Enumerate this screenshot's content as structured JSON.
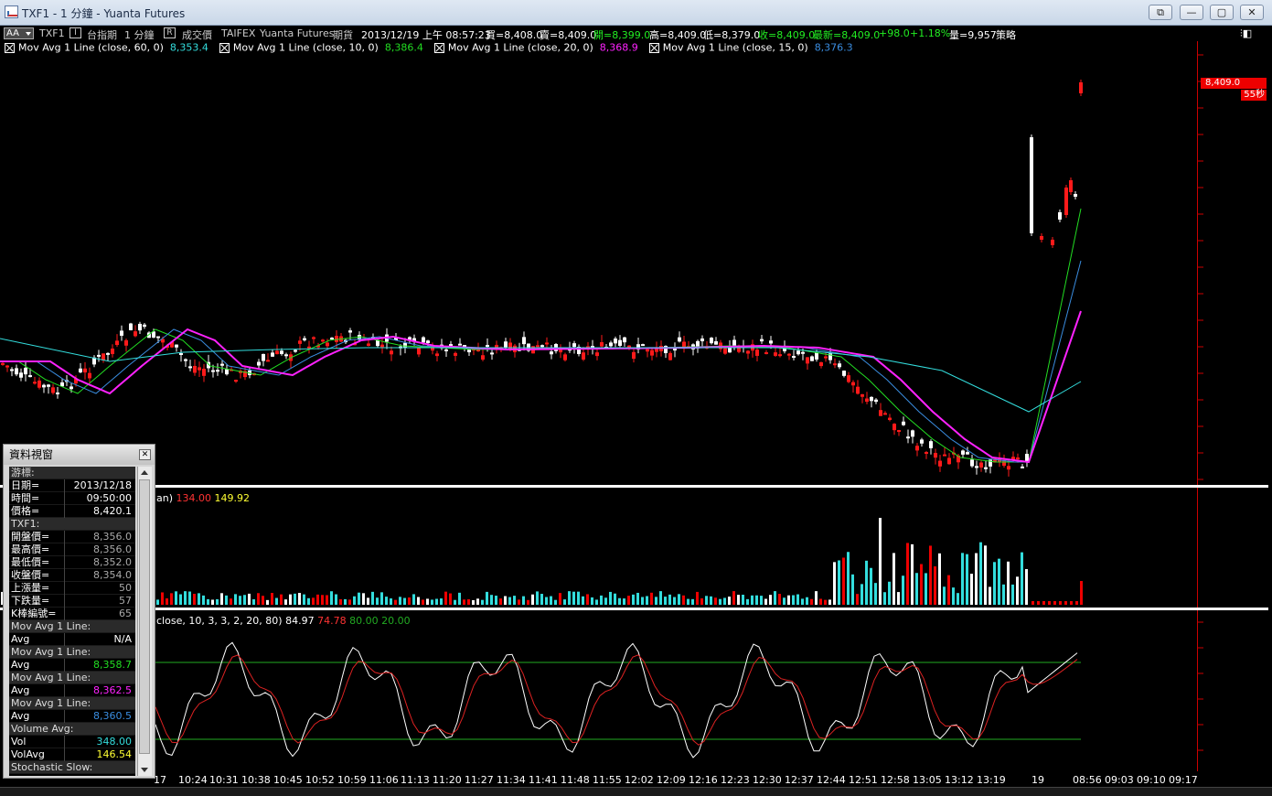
{
  "window": {
    "title": "TXF1 - 1 分鐘 - Yuanta Futures",
    "buttons": [
      "⧉",
      "—",
      "▢",
      "✕"
    ]
  },
  "toolbar": {
    "font_btn": "AA",
    "symbol": "TXF1",
    "box1": "I",
    "name": "台指期",
    "interval": "1 分鐘",
    "box2": "R",
    "price_type": "成交價",
    "exchange": "TAIFEX",
    "broker": "Yuanta Futures",
    "product": "期貨",
    "datetime": "2013/12/19  上午 08:57:23",
    "bid": "買=8,408.0",
    "ask": "賣=8,409.0",
    "open": "開=8,399.0",
    "high": "高=8,409.0",
    "low": "低=8,379.0",
    "close": "收=8,409.0",
    "last": "最新=8,409.0",
    "change": "+98.0",
    "change_pct": "+1.18%",
    "volume": "量=9,957",
    "strategy": "策略",
    "right_icon": "⫶◧"
  },
  "indicators": [
    {
      "label": "Mov Avg 1 Line  (close,  60,  0)",
      "value": "8,353.4",
      "color": "#33dddd"
    },
    {
      "label": "Mov Avg 1 Line  (close,  10,  0)",
      "value": "8,386.4",
      "color": "#22dd22"
    },
    {
      "label": "Mov Avg 1 Line  (close,  20,  0)",
      "value": "8,368.9",
      "color": "#ff22ff"
    },
    {
      "label": "Mov Avg 1 Line  (close,  15,  0)",
      "value": "8,376.3",
      "color": "#3a8de0"
    }
  ],
  "price_axis": {
    "tag": "8,409.0",
    "tag2": "55秒"
  },
  "volume_panel": {
    "label": "an)",
    "v1": "134.00",
    "v1_color": "#ff3333",
    "v2": "149.92",
    "v2_color": "#ffff33"
  },
  "stoch_panel": {
    "label": "close,  10,  3,  3,  2,  20,  80)",
    "v1": "84.97",
    "v2": "74.78",
    "v2_color": "#ff3333",
    "v3": "80.00",
    "v3_color": "#22aa22",
    "v4": "20.00",
    "v4_color": "#22aa22"
  },
  "time_labels": [
    "17",
    "10:24",
    "10:31",
    "10:38",
    "10:45",
    "10:52",
    "10:59",
    "11:06",
    "11:13",
    "11:20",
    "11:27",
    "11:34",
    "11:41",
    "11:48",
    "11:55",
    "12:02",
    "12:09",
    "12:16",
    "12:23",
    "12:30",
    "12:37",
    "12:44",
    "12:51",
    "12:58",
    "13:05",
    "13:12",
    "13:19",
    "19",
    "08:56",
    "09:03",
    "09:10",
    "09:17"
  ],
  "data_window": {
    "title": "資料視窗",
    "close": "✕",
    "rows": [
      {
        "k": "游標:",
        "v": "",
        "sec": true
      },
      {
        "k": "日期=",
        "v": "2013/12/18"
      },
      {
        "k": "時間=",
        "v": "09:50:00"
      },
      {
        "k": "價格=",
        "v": "8,420.1"
      },
      {
        "k": "TXF1:",
        "v": "",
        "sec": true
      },
      {
        "k": "開盤價=",
        "v": "8,356.0",
        "dim": true
      },
      {
        "k": "最高價=",
        "v": "8,356.0",
        "dim": true
      },
      {
        "k": "最低價=",
        "v": "8,352.0",
        "dim": true
      },
      {
        "k": "收盤價=",
        "v": "8,354.0",
        "dim": true
      },
      {
        "k": "上漲量=",
        "v": "50",
        "dim": true
      },
      {
        "k": "下跌量=",
        "v": "57",
        "dim": true
      },
      {
        "k": "K棒編號=",
        "v": "65",
        "dim": true
      },
      {
        "k": "Mov Avg 1 Line:",
        "v": "",
        "sec": true
      },
      {
        "k": "Avg",
        "v": "N/A"
      },
      {
        "k": "Mov Avg 1 Line:",
        "v": "",
        "sec": true
      },
      {
        "k": "Avg",
        "v": "8,358.7",
        "color": "#22dd22"
      },
      {
        "k": "Mov Avg 1 Line:",
        "v": "",
        "sec": true
      },
      {
        "k": "Avg",
        "v": "8,362.5",
        "color": "#ff22ff"
      },
      {
        "k": "Mov Avg 1 Line:",
        "v": "",
        "sec": true
      },
      {
        "k": "Avg",
        "v": "8,360.5",
        "color": "#3a8de0"
      },
      {
        "k": "Volume Avg:",
        "v": "",
        "sec": true
      },
      {
        "k": "Vol",
        "v": "348.00",
        "color": "#33dddd"
      },
      {
        "k": "VolAvg",
        "v": "146.54",
        "color": "#ffff33"
      },
      {
        "k": "Stochastic Slow:",
        "v": "",
        "sec": true
      }
    ]
  },
  "colors": {
    "up": "#ff1a1a",
    "down": "#ffffff",
    "vol_cyan": "#33dddd",
    "grid": "#222222"
  }
}
